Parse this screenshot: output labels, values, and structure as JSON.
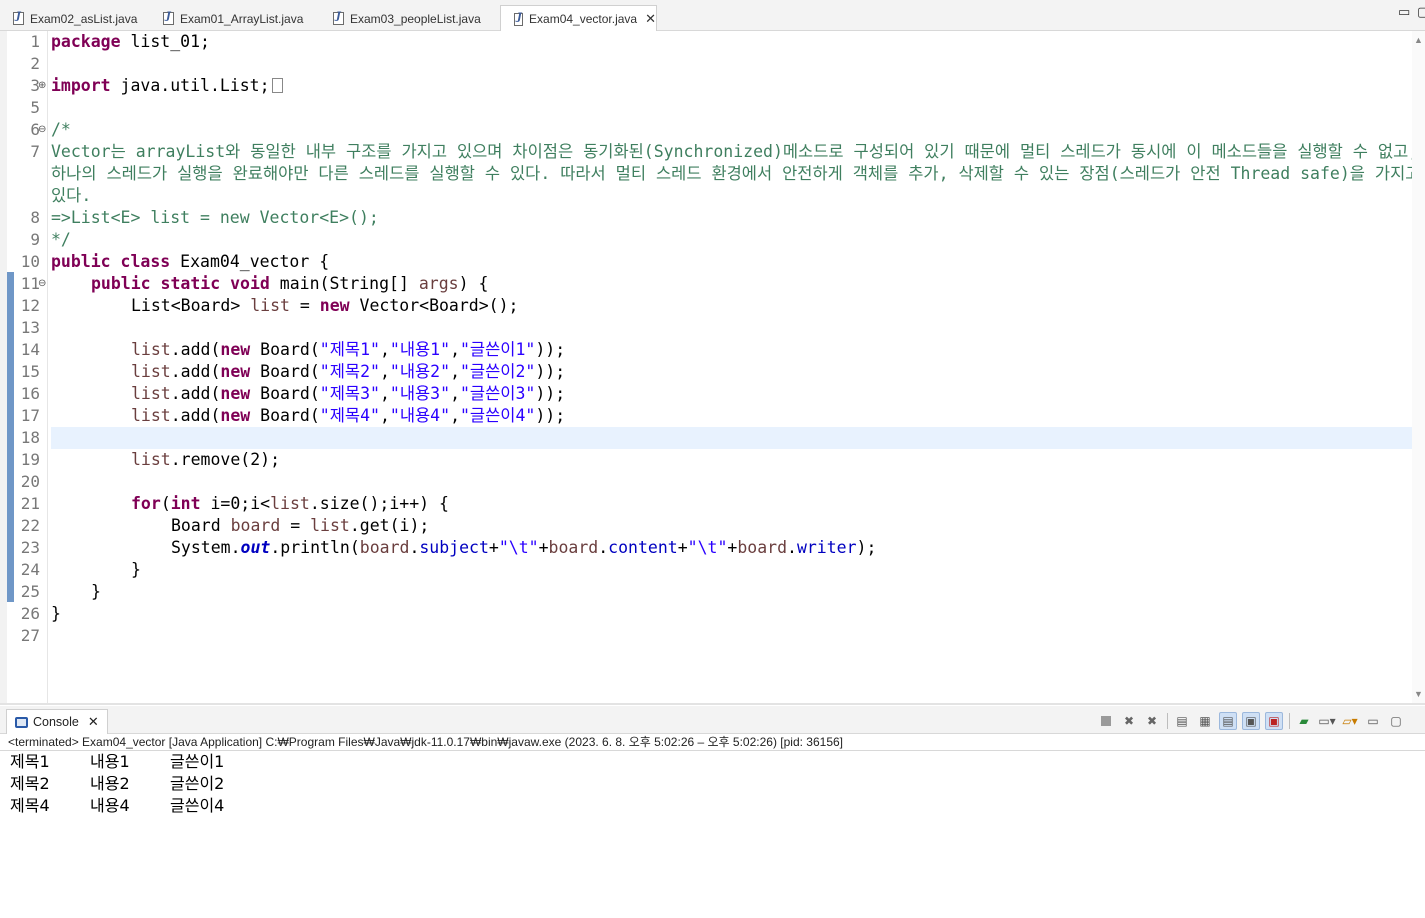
{
  "editor_tabs": [
    {
      "label": "Exam02_asList.java",
      "active": false
    },
    {
      "label": "Exam01_ArrayList.java",
      "active": false
    },
    {
      "label": "Exam03_peopleList.java",
      "active": false
    },
    {
      "label": "Exam04_vector.java",
      "active": true
    }
  ],
  "window_controls": {
    "minimize": "▭",
    "maximize": "▢"
  },
  "code": {
    "line_numbers": [
      "1",
      "2",
      "3",
      "5",
      "6",
      "7",
      "8",
      "9",
      "10",
      "11",
      "12",
      "13",
      "14",
      "15",
      "16",
      "17",
      "18",
      "19",
      "20",
      "21",
      "22",
      "23",
      "24",
      "25",
      "26",
      "27"
    ],
    "current_line": "18",
    "l1_kw": "package",
    "l1_rest": " list_01;",
    "l3_kw": "import",
    "l3_rest": " java.util.List;",
    "l6": "/*",
    "l7a": "Vector는 arrayList와 동일한 내부 구조를 가지고 있으며 차이점은 동기화된(Synchronized)메소드로 구성되어 있기 때문에 멀티 스레드가 동시에 이 메소드들을 실행할 수 없고,",
    "l7b": "하나의 스레드가 실행을 완료해야만 다른 스레드를 실행할 수 있다. 따라서 멀티 스레드 환경에서 안전하게 객체를 추가, 삭제할 수 있는 장점(스레드가 안전 Thread safe)을 가지고",
    "l7c": "있다.",
    "l8": "=>List<E> list = new Vector<E>();",
    "l9": "*/",
    "l10_kw1": "public",
    "l10_kw2": "class",
    "l10_rest": " Exam04_vector {",
    "l11_kw1": "public",
    "l11_kw2": "static",
    "l11_kw3": "void",
    "l11_a": " main(String[] ",
    "l11_var": "args",
    "l11_b": ") {",
    "l12_a": "List<Board> ",
    "l12_var": "list",
    "l12_b": " = ",
    "l12_kw": "new",
    "l12_c": " Vector<Board>();",
    "adds": [
      {
        "title": "\"제목1\"",
        "content": "\"내용1\"",
        "writer": "\"글쓴이1\""
      },
      {
        "title": "\"제목2\"",
        "content": "\"내용2\"",
        "writer": "\"글쓴이2\""
      },
      {
        "title": "\"제목3\"",
        "content": "\"내용3\"",
        "writer": "\"글쓴이3\""
      },
      {
        "title": "\"제목4\"",
        "content": "\"내용4\"",
        "writer": "\"글쓴이4\""
      }
    ],
    "add_prefix": ".add(",
    "new_kw": "new",
    "board_ctor": " Board(",
    "comma": ",",
    "add_suffix": "));",
    "list_var": "list",
    "l19_rest": ".remove(2);",
    "l21_kw1": "for",
    "l21_a": "(",
    "l21_kw2": "int",
    "l21_b": " i=0;i<",
    "l21_c": ".size();i++) {",
    "l22_a": "Board ",
    "l22_var": "board",
    "l22_b": " = ",
    "l22_c": ".get(i);",
    "l23_a": "System.",
    "l23_out": "out",
    "l23_b": ".println(",
    "l23_board": "board",
    "l23_dot": ".",
    "l23_subject": "subject",
    "l23_plus": "+",
    "l23_tab": "\"\\t\"",
    "l23_content": "content",
    "l23_writer": "writer",
    "l23_end": ");",
    "brace": "}"
  },
  "console": {
    "tab_label": "Console",
    "status": "<terminated> Exam04_vector [Java Application] C:₩Program Files₩Java₩jdk-11.0.17₩bin₩javaw.exe  (2023. 6. 8. 오후 5:02:26 – 오후 5:02:26) [pid: 36156]",
    "output": [
      [
        "제목1",
        "내용1",
        "글쓴이1"
      ],
      [
        "제목2",
        "내용2",
        "글쓴이2"
      ],
      [
        "제목4",
        "내용4",
        "글쓴이4"
      ]
    ]
  }
}
